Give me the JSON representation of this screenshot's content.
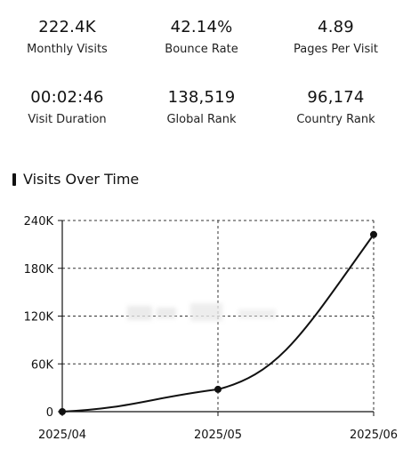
{
  "stats": [
    {
      "value": "222.4K",
      "label": "Monthly Visits"
    },
    {
      "value": "42.14%",
      "label": "Bounce Rate"
    },
    {
      "value": "4.89",
      "label": "Pages Per Visit"
    },
    {
      "value": "00:02:46",
      "label": "Visit Duration"
    },
    {
      "value": "138,519",
      "label": "Global Rank"
    },
    {
      "value": "96,174",
      "label": "Country Rank"
    }
  ],
  "section_title": "Visits Over Time",
  "chart_data": {
    "type": "line",
    "title": "",
    "xlabel": "",
    "ylabel": "",
    "categories": [
      "2025/04",
      "2025/05",
      "2025/06"
    ],
    "series": [
      {
        "values": [
          0,
          28000,
          222400
        ]
      }
    ],
    "ylim": [
      0,
      240000
    ],
    "yticks": [
      0,
      60000,
      120000,
      180000,
      240000
    ],
    "ytick_labels": [
      "0",
      "60K",
      "120K",
      "180K",
      "240K"
    ],
    "grid": true,
    "legend": "none",
    "colors": {
      "line": "#111111",
      "grid": "#333333"
    }
  }
}
